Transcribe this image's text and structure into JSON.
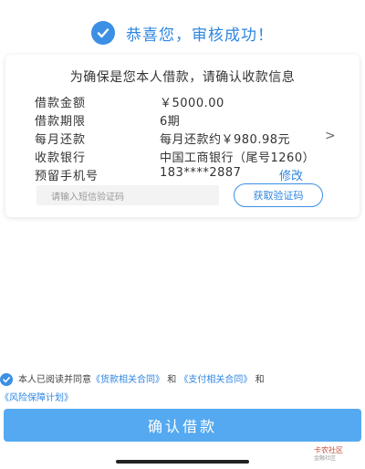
{
  "success": {
    "message": "恭喜您，审核成功！",
    "accent_color": "#3b8fe5",
    "icon": "check-circle-icon"
  },
  "card": {
    "title": "为确保是您本人借款，请确认收款信息",
    "rows": [
      {
        "label": "借款金额",
        "value": "￥5000.00"
      },
      {
        "label": "借款期限",
        "value": "6期"
      },
      {
        "label": "每月还款",
        "value": "每月还款约￥980.98元",
        "chevron": ">"
      },
      {
        "label": "收款银行",
        "value": "中国工商银行（尾号1260）"
      },
      {
        "label": "预留手机号",
        "value": "183****2887",
        "action": "修改"
      }
    ],
    "sms_placeholder": "请输入短信验证码",
    "get_code_label": "获取验证码"
  },
  "agreement": {
    "prefix": "本人已阅读并同意",
    "link1": "《货款相关合同》",
    "and1": "和",
    "link2": "《支付相关合同》",
    "and2": "和",
    "link3": "《风险保障计划》"
  },
  "confirm_label": "确认借款",
  "watermark": {
    "brand": "卡农社区",
    "sub": "金融社区"
  }
}
